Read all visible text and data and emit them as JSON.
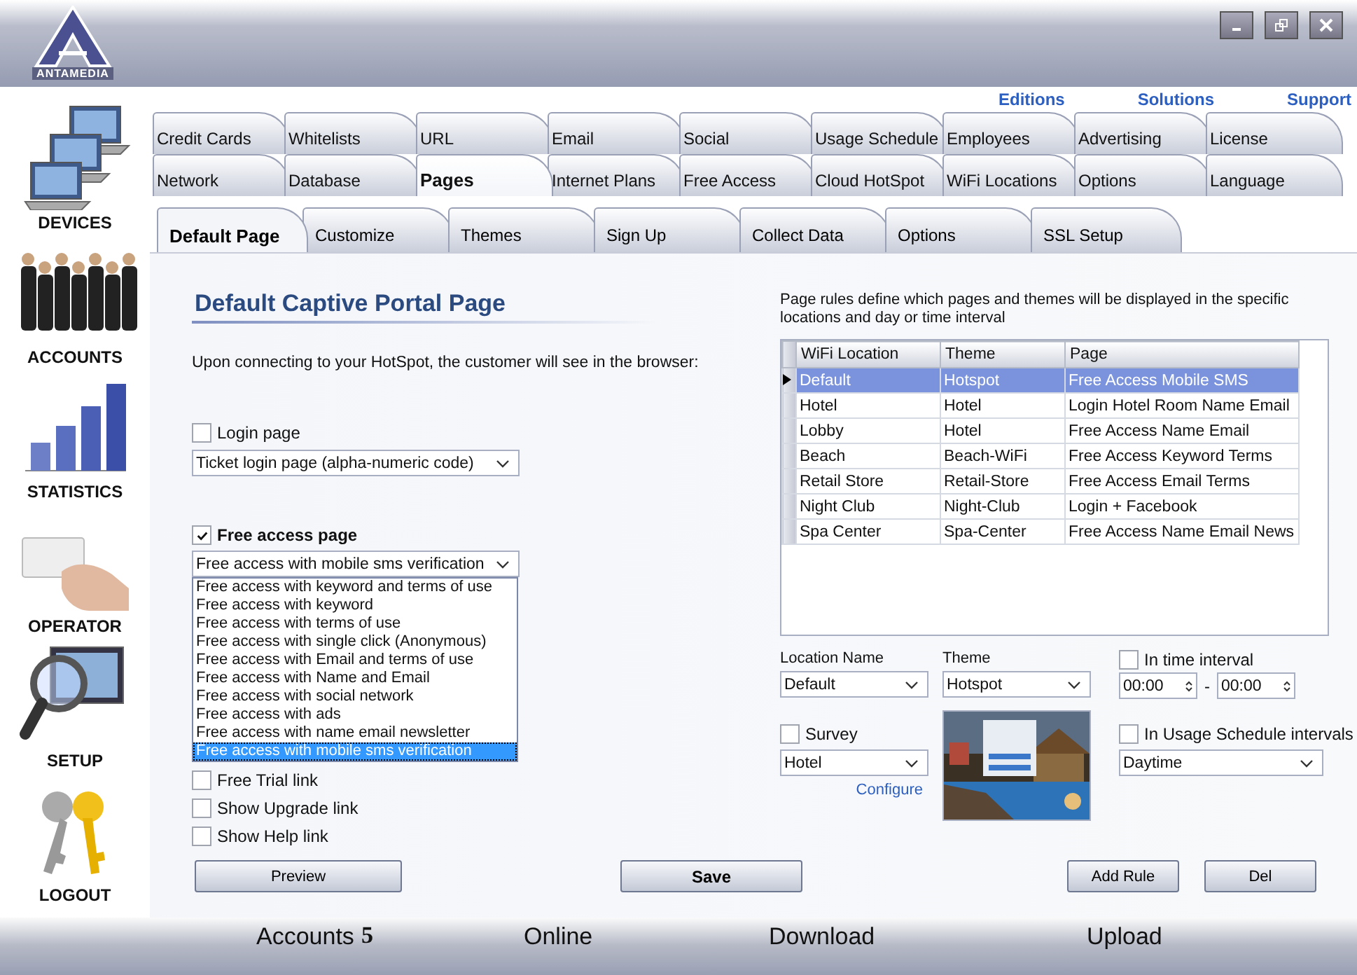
{
  "window": {
    "logo": "ANTAMEDIA"
  },
  "sidebar": [
    {
      "label": "DEVICES",
      "kind": "devices"
    },
    {
      "label": "ACCOUNTS",
      "kind": "accounts"
    },
    {
      "label": "STATISTICS",
      "kind": "statistics"
    },
    {
      "label": "OPERATOR",
      "kind": "operator"
    },
    {
      "label": "SETUP",
      "kind": "setup"
    },
    {
      "label": "LOGOUT",
      "kind": "logout"
    }
  ],
  "top_links": [
    "Editions",
    "Solutions",
    "Support"
  ],
  "tab_rows": [
    [
      {
        "label": "Credit Cards",
        "selected": false
      },
      {
        "label": "Whitelists",
        "selected": false
      },
      {
        "label": "URL",
        "selected": false
      },
      {
        "label": "Email",
        "selected": false
      },
      {
        "label": "Social",
        "selected": false
      },
      {
        "label": "Usage Schedule",
        "selected": false
      },
      {
        "label": "Employees",
        "selected": false
      },
      {
        "label": "Advertising",
        "selected": false
      },
      {
        "label": "License",
        "selected": false
      }
    ],
    [
      {
        "label": "Network",
        "selected": false
      },
      {
        "label": "Database",
        "selected": false
      },
      {
        "label": "Pages",
        "selected": true
      },
      {
        "label": "Internet Plans",
        "selected": false
      },
      {
        "label": "Free Access",
        "selected": false
      },
      {
        "label": "Cloud HotSpot",
        "selected": false
      },
      {
        "label": "WiFi Locations",
        "selected": false
      },
      {
        "label": "Options",
        "selected": false
      },
      {
        "label": "Language",
        "selected": false
      }
    ]
  ],
  "subtabs": [
    {
      "label": "Default Page",
      "selected": true
    },
    {
      "label": "Customize",
      "selected": false
    },
    {
      "label": "Themes",
      "selected": false
    },
    {
      "label": "Sign Up",
      "selected": false
    },
    {
      "label": "Collect Data",
      "selected": false
    },
    {
      "label": "Options",
      "selected": false
    },
    {
      "label": "SSL Setup",
      "selected": false
    }
  ],
  "page_title": "Default Captive Portal Page",
  "intro": "Upon connecting to your HotSpot, the customer will see in the browser:",
  "login_page": {
    "label": "Login page",
    "checked": false,
    "select": "Ticket login page (alpha-numeric code)"
  },
  "free_access": {
    "label": "Free access page",
    "checked": true,
    "select": "Free access with mobile sms verification",
    "options": [
      {
        "label": "Free access with keyword and terms of use",
        "selected": false
      },
      {
        "label": "Free access with keyword",
        "selected": false
      },
      {
        "label": "Free access with terms of use",
        "selected": false
      },
      {
        "label": "Free access with single click (Anonymous)",
        "selected": false
      },
      {
        "label": "Free access with Email and terms of use",
        "selected": false
      },
      {
        "label": "Free access with Name and Email",
        "selected": false
      },
      {
        "label": "Free access with social network",
        "selected": false
      },
      {
        "label": "Free access with ads",
        "selected": false
      },
      {
        "label": "Free access with name email newsletter",
        "selected": false
      },
      {
        "label": "Free access with mobile sms verification",
        "selected": true
      }
    ]
  },
  "checkboxes": [
    {
      "label": "Free Trial link",
      "checked": false
    },
    {
      "label": "Show Upgrade link",
      "checked": false
    },
    {
      "label": "Show Help link",
      "checked": false
    }
  ],
  "rules_text": "Page rules define which pages and themes will be displayed in the specific locations and day or time interval",
  "table": {
    "columns": [
      "WiFi Location",
      "Theme",
      "Page"
    ],
    "rows": [
      {
        "cells": [
          "Default",
          "Hotspot",
          "Free Access Mobile SMS"
        ],
        "selected": true
      },
      {
        "cells": [
          "Hotel",
          "Hotel",
          "Login Hotel Room Name Email"
        ],
        "selected": false
      },
      {
        "cells": [
          "Lobby",
          "Hotel",
          "Free Access Name Email"
        ],
        "selected": false
      },
      {
        "cells": [
          "Beach",
          "Beach-WiFi",
          "Free Access Keyword Terms"
        ],
        "selected": false
      },
      {
        "cells": [
          "Retail Store",
          "Retail-Store",
          "Free Access Email Terms"
        ],
        "selected": false
      },
      {
        "cells": [
          "Night Club",
          "Night-Club",
          "Login + Facebook"
        ],
        "selected": false
      },
      {
        "cells": [
          "Spa Center",
          "Spa-Center",
          "Free Access Name Email News"
        ],
        "selected": false
      }
    ]
  },
  "location": {
    "label": "Location Name",
    "value": "Default"
  },
  "theme": {
    "label": "Theme",
    "value": "Hotspot"
  },
  "survey": {
    "label": "Survey",
    "checked": false,
    "value": "Hotel",
    "link": "Configure"
  },
  "time_interval": {
    "label": "In time interval",
    "checked": false,
    "from": "00:00",
    "to": "00:00",
    "separator": "-"
  },
  "usage_schedule": {
    "label": "In Usage Schedule intervals",
    "checked": false,
    "value": "Daytime"
  },
  "buttons": [
    {
      "label": "Preview",
      "kind": "normal"
    },
    {
      "label": "Save",
      "kind": "primary"
    },
    {
      "label": "Add Rule",
      "kind": "normal"
    },
    {
      "label": "Del",
      "kind": "normal"
    }
  ],
  "status": [
    {
      "label": "Accounts",
      "value": "5"
    },
    {
      "label": "Online"
    },
    {
      "label": "Download"
    },
    {
      "label": "Upload"
    }
  ]
}
